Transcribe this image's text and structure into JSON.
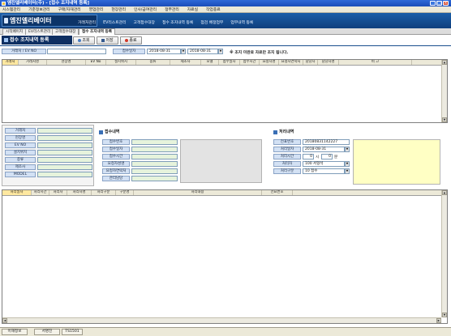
{
  "window": {
    "title": "엠진엘리베이터(주) - [접수 조지내역 등록]",
    "min": "_",
    "max": "□",
    "close": "×"
  },
  "menubar": [
    "시스템관리",
    "기준정보관리",
    "구매/자재관리",
    "영업관리",
    "현장관리",
    "인사/급여관리",
    "정부관리",
    "자료실",
    "작업종료"
  ],
  "banner": {
    "logo": "엠진엘리베이터"
  },
  "topmenu": [
    "거래처관리",
    "EV리스트관리",
    "고객접수대장",
    "접수 조지내역 등록",
    "점검 배정업무",
    "업무내역 등록"
  ],
  "tabs": [
    "시작페이지",
    "EV리스트관리",
    "고객접수대장",
    "접수 조지내역 등록"
  ],
  "form": {
    "title": "접수 조지내역 등록",
    "buttons": {
      "search": "조회",
      "save": "저장",
      "close": "종료"
    },
    "filters": {
      "client_label": "거래처 / EV NO",
      "client_value": "",
      "date_label": "접수일자",
      "date_from": "2018-08-31",
      "date_to": "2018-08-31",
      "note": "※ 조지 미완료 자료만 조지 됩니다."
    }
  },
  "top_grid": {
    "columns": [
      "거래처",
      "거래처명",
      "현장명",
      "EV No",
      "설치위치",
      "종류",
      "제조사",
      "모델",
      "접수일자",
      "접수시간",
      "요청자명",
      "요청자연락처",
      "담당자",
      "담당자명",
      "비 고"
    ]
  },
  "client_panel": {
    "labels": [
      "거래처",
      "현장명",
      "EV NO",
      "설치위치",
      "종류",
      "제조사",
      "MODEL"
    ]
  },
  "receipt_panel": {
    "title": "접수내역",
    "labels": [
      "접수번호",
      "접수일자",
      "접수시간",
      "요청자성명",
      "요청자연락처",
      "관리담당"
    ]
  },
  "process_panel": {
    "title": "처리내역",
    "labels": [
      "전표번호",
      "처리일자",
      "처리시간",
      "처리자",
      "처리구분"
    ],
    "values": {
      "slip_no": "20180831142227",
      "date": "2018-08-31",
      "hour": "0",
      "hour_unit": "시",
      "minute": "0",
      "minute_unit": "분",
      "handler": "100 서형석",
      "type": "10 접수"
    }
  },
  "bottom_grid": {
    "columns": [
      "처리일자",
      "처리시간",
      "처리자",
      "처리자명",
      "처리구분",
      "구분명",
      "처리내용",
      "전표번호"
    ]
  },
  "statusbar": [
    "이해정보",
    "서명진",
    "TS1501"
  ]
}
